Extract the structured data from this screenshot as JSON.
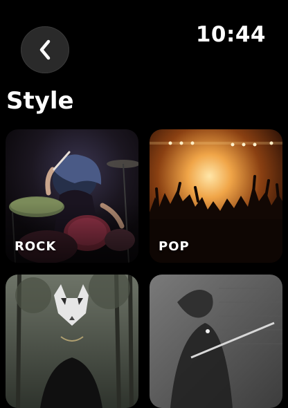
{
  "status_bar": {
    "time": "10:44"
  },
  "nav": {
    "back_icon": "chevron-left-icon"
  },
  "page": {
    "title": "Style"
  },
  "styles": [
    {
      "label": "ROCK",
      "image": "drummer-concert-photo"
    },
    {
      "label": "POP",
      "image": "stage-crowd-photo"
    },
    {
      "label": "",
      "image": "masked-person-forest-photo"
    },
    {
      "label": "",
      "image": "guitarist-bw-photo"
    }
  ],
  "colors": {
    "background": "#000000",
    "button_bg": "#2a2a2a",
    "text": "#ffffff"
  }
}
